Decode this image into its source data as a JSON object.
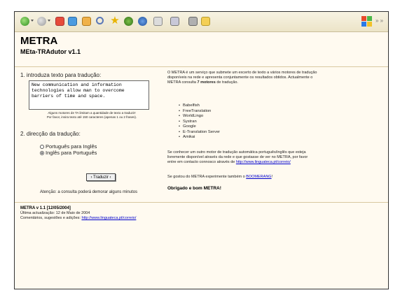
{
  "header": {
    "title": "METRA",
    "subtitle": "MEta-TRAdutor v1.1"
  },
  "form": {
    "step1_label": "1. introduza texto para tradução:",
    "text_value": "New communication and information\ntechnologies allow man to overcome\nbarriers of time and space.",
    "limit_note": "Alguns motores de TA limitam a quantidade de texto a traduzir!\nPor favor, insira texto até 150 caracteres (apenas 1 ou 2 frases).",
    "step2_label": "2. direcção da tradução:",
    "option_pt_en": "Português para Inglês",
    "option_en_pt": "Inglês para Português",
    "translate_button": "› Traduzir ‹",
    "warning": "Atenção: a consulta poderá demorar alguns minutos"
  },
  "info": {
    "intro_pre": "O METRA é um serviço que submete um excerto de texto a vários motores de tradução disponíveis na rede e apresenta conjuntamente os resultados obtidos. Actualmente o METRA consulta ",
    "intro_bold": "7 motores",
    "intro_post": " de tradução.",
    "engines": [
      "Babelfish",
      "FreeTranslation",
      "WorldLingo",
      "Systran",
      "Google",
      "E-Translation Server",
      "Amikai"
    ],
    "contact_pre": "Se conhecer um outro motor de tradução automática português/inglês que esteja livremente disponível através da rede e que gostasse de ver no METRA, por favor entre em contacto connosco através de ",
    "contact_link": "http://www.linguateca.pt/correio/",
    "boomerang_pre": "Se gostou do METRA experimente também o ",
    "boomerang_link": "BOOMERANG",
    "boomerang_post": "!",
    "thanks": "Obrigado e bom METRA!"
  },
  "footer": {
    "version": "METRA v 1.1 [12/05/2004]",
    "updated": "Última actualização: 12 de Maio de 2004",
    "comments_label": "Comentários, sugestões e adições: ",
    "comments_link": "http://www.linguateca.pt/correio/"
  },
  "colors": {
    "page_bg": "#fffaf0",
    "link": "#0000cc"
  }
}
